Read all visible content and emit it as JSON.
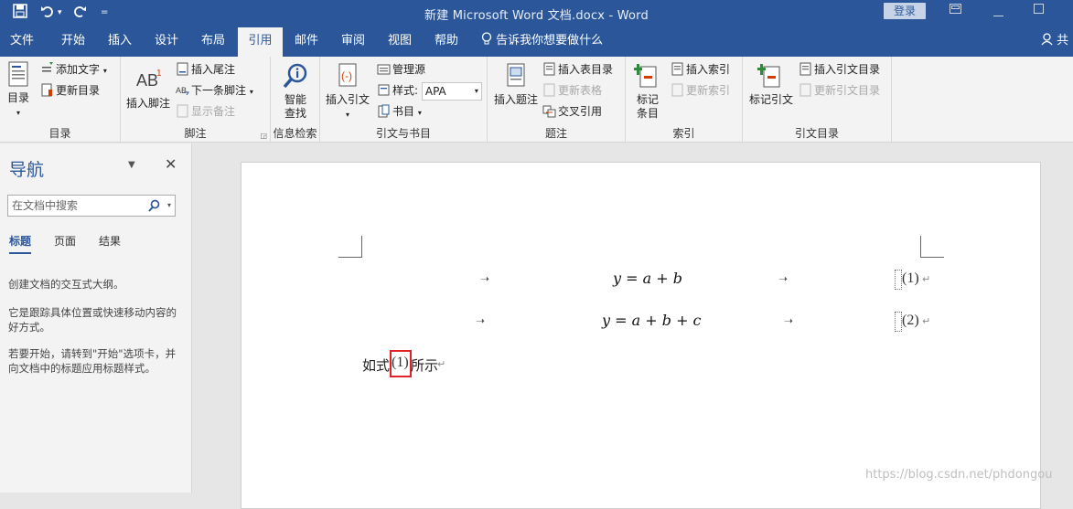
{
  "window": {
    "title": "新建 Microsoft Word 文档.docx  -  Word",
    "login": "登录"
  },
  "tabs": [
    "文件",
    "开始",
    "插入",
    "设计",
    "布局",
    "引用",
    "邮件",
    "审阅",
    "视图",
    "帮助"
  ],
  "active_tab": "引用",
  "tell_me": "告诉我你想要做什么",
  "share": "共",
  "ribbon": {
    "toc": {
      "big": "目录",
      "add_text": "添加文字",
      "update": "更新目录",
      "label": "目录"
    },
    "footnotes": {
      "insert": "插入脚注",
      "insert_endnote": "插入尾注",
      "next": "下一条脚注",
      "show_notes": "显示备注",
      "label": "脚注"
    },
    "research": {
      "smart_lookup_1": "智能",
      "smart_lookup_2": "查找",
      "label": "信息检索"
    },
    "citations": {
      "insert": "插入引文",
      "manage": "管理源",
      "style_label": "样式:",
      "style_value": "APA",
      "bibliography": "书目",
      "label": "引文与书目"
    },
    "captions": {
      "insert": "插入题注",
      "insert_tof": "插入表目录",
      "update_table": "更新表格",
      "cross_ref": "交叉引用",
      "label": "题注"
    },
    "index": {
      "mark_1": "标记",
      "mark_2": "条目",
      "insert": "插入索引",
      "update": "更新索引",
      "label": "索引"
    },
    "toa": {
      "mark": "标记引文",
      "insert": "插入引文目录",
      "update": "更新引文目录",
      "label": "引文目录"
    }
  },
  "nav": {
    "title": "导航",
    "search_placeholder": "在文档中搜索",
    "tabs": [
      "标题",
      "页面",
      "结果"
    ],
    "text1": "创建文档的交互式大纲。",
    "text2": "它是跟踪具体位置或快速移动内容的好方式。",
    "text3": "若要开始，请转到\"开始\"选项卡，并向文档中的标题应用标题样式。"
  },
  "document": {
    "eq1": "y = a + b",
    "eq1_num": "(1)",
    "eq2": "y = a + b + c",
    "eq2_num": "(2)",
    "sentence_before": "如式",
    "sentence_ref": "(1)",
    "sentence_after": "所示"
  },
  "watermark": "https://blog.csdn.net/phdongou",
  "colors": {
    "brand": "#2b579a",
    "highlight": "#e0202a"
  }
}
